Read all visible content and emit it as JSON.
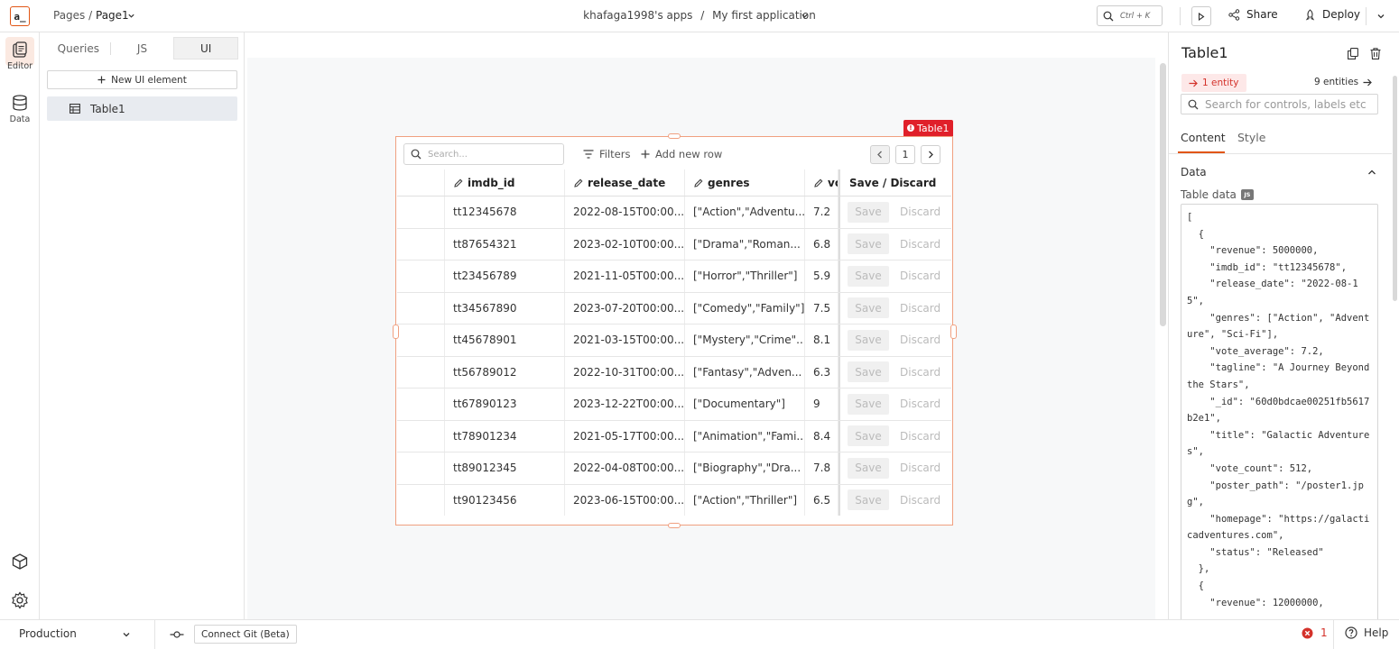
{
  "topbar": {
    "logo_text": "a_",
    "pages_label": "Pages /",
    "page_name": "Page1",
    "workspace": "khafaga1998's apps",
    "separator": "/",
    "app_name": "My first application",
    "search_shortcut": "Ctrl + K",
    "share_label": "Share",
    "deploy_label": "Deploy"
  },
  "rail": {
    "editor_label": "Editor",
    "data_label": "Data"
  },
  "explorer": {
    "tabs": [
      "Queries",
      "JS",
      "UI"
    ],
    "active_tab": "UI",
    "new_ui_label": "New UI element",
    "widgets": [
      "Table1"
    ]
  },
  "widget": {
    "tag_label": "Table1",
    "search_placeholder": "Search...",
    "filters_label": "Filters",
    "add_row_label": "Add new row",
    "page_number": "1",
    "columns": [
      "",
      "imdb_id",
      "release_date",
      "genres",
      "vc",
      "Save / Discard"
    ],
    "save_label": "Save",
    "discard_label": "Discard",
    "rows": [
      [
        "tt12345678",
        "2022-08-15T00:00...",
        "[\"Action\",\"Adventu...",
        "7.2"
      ],
      [
        "tt87654321",
        "2023-02-10T00:00...",
        "[\"Drama\",\"Roman...",
        "6.8"
      ],
      [
        "tt23456789",
        "2021-11-05T00:00...",
        "[\"Horror\",\"Thriller\"]",
        "5.9"
      ],
      [
        "tt34567890",
        "2023-07-20T00:00...",
        "[\"Comedy\",\"Family\"]",
        "7.5"
      ],
      [
        "tt45678901",
        "2021-03-15T00:00...",
        "[\"Mystery\",\"Crime\"...",
        "8.1"
      ],
      [
        "tt56789012",
        "2022-10-31T00:00...",
        "[\"Fantasy\",\"Adven...",
        "6.3"
      ],
      [
        "tt67890123",
        "2023-12-22T00:00...",
        "[\"Documentary\"]",
        "9"
      ],
      [
        "tt78901234",
        "2021-05-17T00:00...",
        "[\"Animation\",\"Fami...",
        "8.4"
      ],
      [
        "tt89012345",
        "2022-04-08T00:00...",
        "[\"Biography\",\"Dra...",
        "7.8"
      ],
      [
        "tt90123456",
        "2023-06-15T00:00...",
        "[\"Action\",\"Thriller\"]",
        "6.5"
      ]
    ]
  },
  "props": {
    "title": "Table1",
    "entity_error": "1 entity",
    "entities": "9 entities",
    "search_placeholder": "Search for controls, labels etc",
    "tab_content": "Content",
    "tab_style": "Style",
    "section_data": "Data",
    "table_data_label": "Table data",
    "js_badge": "JS",
    "code": "[\n  {\n    \"revenue\": 5000000,\n    \"imdb_id\": \"tt12345678\",\n    \"release_date\": \"2022-08-15\",\n    \"genres\": [\"Action\", \"Adventure\", \"Sci-Fi\"],\n    \"vote_average\": 7.2,\n    \"tagline\": \"A Journey Beyond the Stars\",\n    \"_id\": \"60d0bdcae00251fb5617b2e1\",\n    \"title\": \"Galactic Adventures\",\n    \"vote_count\": 512,\n    \"poster_path\": \"/poster1.jpg\",\n    \"homepage\": \"https://galacticadventures.com\",\n    \"status\": \"Released\"\n  },\n  {\n    \"revenue\": 12000000,"
  },
  "bottombar": {
    "environment": "Production",
    "git_label": "Connect Git (Beta)",
    "error_count": "1",
    "help_label": "Help"
  },
  "colors": {
    "accent": "#e15615",
    "error": "#e0202a"
  }
}
